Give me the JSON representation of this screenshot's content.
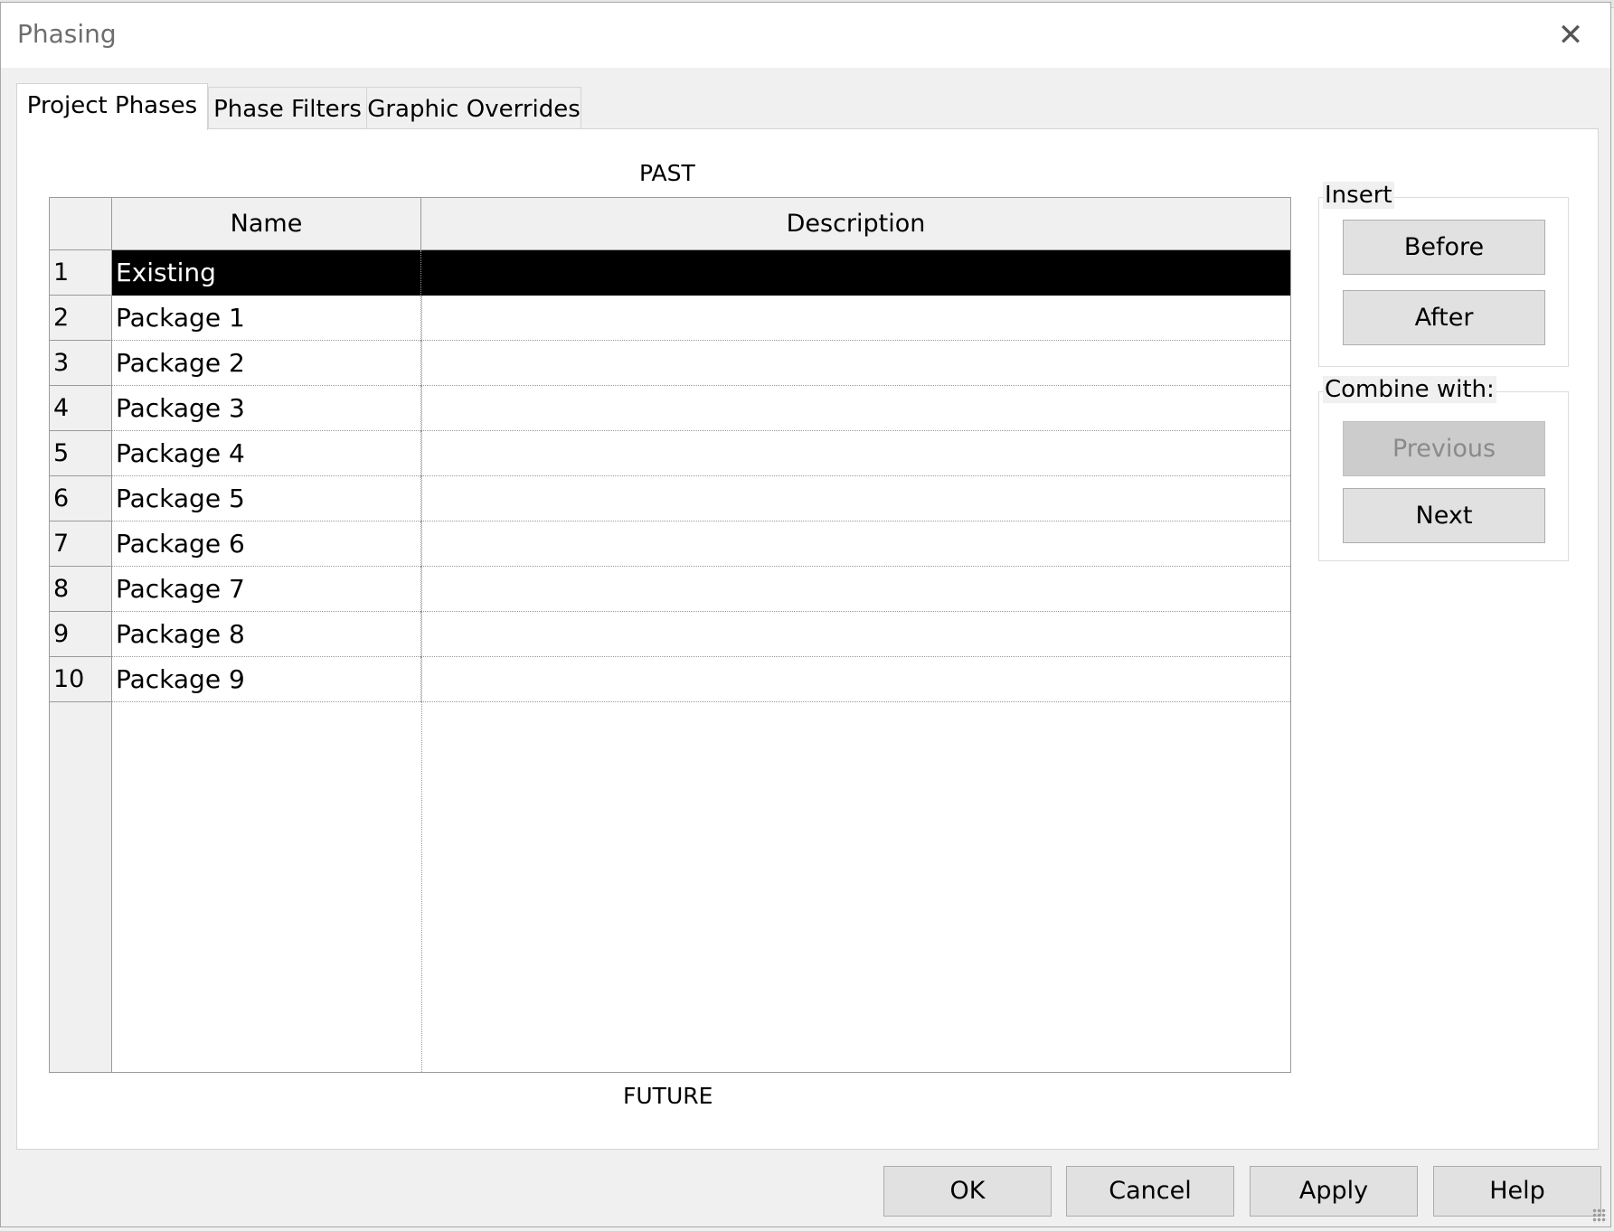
{
  "window": {
    "title": "Phasing",
    "close_glyph": "✕"
  },
  "tabs": [
    {
      "label": "Project Phases",
      "active": true
    },
    {
      "label": "Phase Filters",
      "active": false
    },
    {
      "label": "Graphic Overrides",
      "active": false
    }
  ],
  "table": {
    "top_caption": "PAST",
    "bottom_caption": "FUTURE",
    "columns": [
      "Name",
      "Description"
    ],
    "rows": [
      {
        "num": "1",
        "name": "Existing",
        "description": "",
        "selected": true
      },
      {
        "num": "2",
        "name": "Package 1",
        "description": ""
      },
      {
        "num": "3",
        "name": "Package 2",
        "description": ""
      },
      {
        "num": "4",
        "name": "Package 3",
        "description": ""
      },
      {
        "num": "5",
        "name": "Package 4",
        "description": ""
      },
      {
        "num": "6",
        "name": "Package 5",
        "description": ""
      },
      {
        "num": "7",
        "name": "Package 6",
        "description": ""
      },
      {
        "num": "8",
        "name": "Package 7",
        "description": ""
      },
      {
        "num": "9",
        "name": "Package 8",
        "description": ""
      },
      {
        "num": "10",
        "name": "Package 9",
        "description": ""
      }
    ]
  },
  "insert_group": {
    "label": "Insert",
    "before": "Before",
    "after": "After"
  },
  "combine_group": {
    "label": "Combine with:",
    "previous": "Previous",
    "next": "Next",
    "previous_disabled": true
  },
  "footer": {
    "ok": "OK",
    "cancel": "Cancel",
    "apply": "Apply",
    "help": "Help"
  },
  "colors": {
    "selection": "#000000",
    "dialog_bg": "#f0f0f0",
    "button_bg": "#e1e1e1"
  }
}
